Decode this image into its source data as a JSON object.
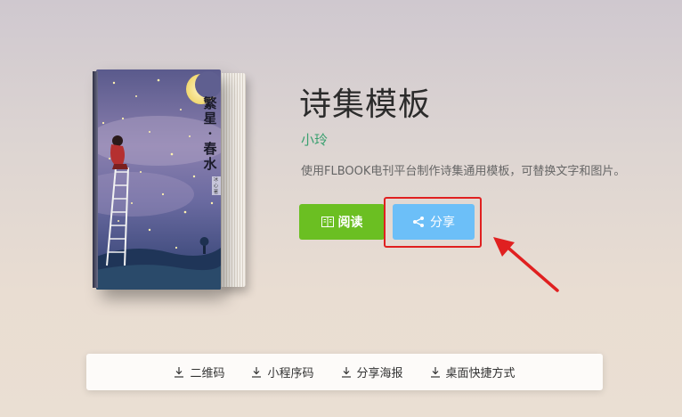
{
  "book": {
    "cover_title": "繁星·春水",
    "cover_author": "冰心著",
    "title": "诗集模板",
    "author": "小玲",
    "description": "使用FLBOOK电刊平台制作诗集通用模板，可替换文字和图片。"
  },
  "actions": {
    "read_label": "阅读",
    "share_label": "分享"
  },
  "downloads": [
    {
      "label": "二维码",
      "icon": "download-icon"
    },
    {
      "label": "小程序码",
      "icon": "download-icon"
    },
    {
      "label": "分享海报",
      "icon": "download-icon"
    },
    {
      "label": "桌面快捷方式",
      "icon": "download-icon"
    }
  ],
  "colors": {
    "read_button": "#6bbf22",
    "share_button": "#6cbff8",
    "highlight": "#e02020",
    "author": "#3aa070"
  }
}
